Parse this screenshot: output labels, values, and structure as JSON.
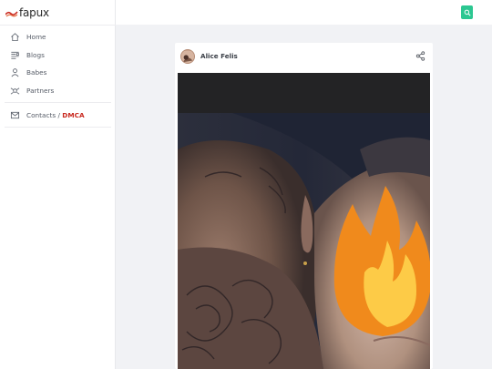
{
  "site": {
    "logo_text": "fapux",
    "logo_icon": "logo-wave-icon"
  },
  "nav": {
    "items": [
      {
        "label": "Home",
        "icon": "home-icon"
      },
      {
        "label": "Blogs",
        "icon": "blogs-icon"
      },
      {
        "label": "Babes",
        "icon": "user-icon"
      },
      {
        "label": "Partners",
        "icon": "partners-icon"
      }
    ],
    "contacts": {
      "label": "Contacts / ",
      "highlight": "DMCA",
      "icon": "mail-icon"
    }
  },
  "topbar": {
    "search_icon": "search-icon"
  },
  "post": {
    "author": "Alice Felis",
    "share_icon": "share-icon",
    "media_overlay_icon": "fire-emoji-icon"
  },
  "colors": {
    "accent": "#2cc791",
    "dmca": "#c8281e",
    "background": "#f1f2f5",
    "fire_orange": "#f08a1c",
    "fire_yellow": "#fdcb47"
  }
}
